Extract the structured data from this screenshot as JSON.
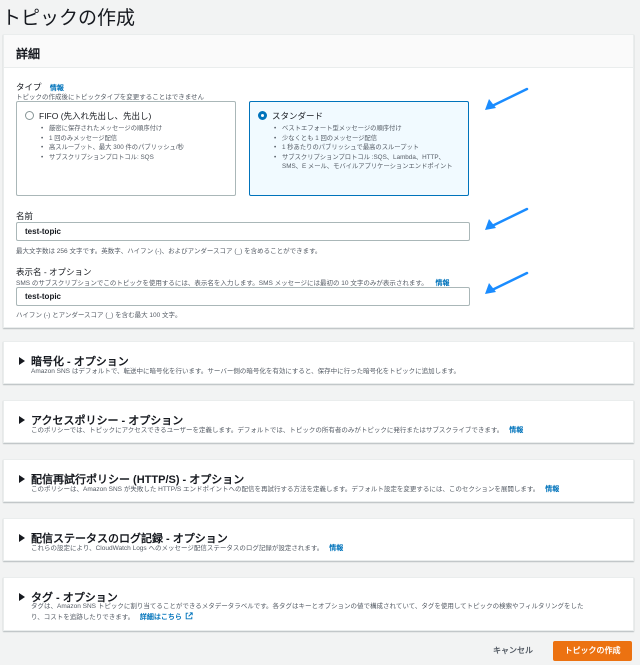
{
  "page": {
    "title": "トピックの作成"
  },
  "details": {
    "title": "詳細",
    "type": {
      "label": "タイプ",
      "info": "情報",
      "hint": "トピックの作成後にトピックタイプを変更することはできません",
      "options": [
        {
          "title": "FIFO (先入れ先出し、先出し)",
          "selected": false,
          "bullets": [
            "厳密に保存されたメッセージの順序付け",
            "1 回のみメッセージ配信",
            "高スループット、最大 300 件のパブリッシュ/秒",
            "サブスクリプションプロトコル: SQS"
          ]
        },
        {
          "title": "スタンダード",
          "selected": true,
          "bullets": [
            "ベストエフォート型メッセージの順序付け",
            "少なくとも 1 回のメッセージ配信",
            "1 秒あたりのパブリッシュで最高のスループット",
            "サブスクリプションプロトコル :SQS、Lambda、HTTP、SMS、E メール、モバイルアプリケーションエンドポイント"
          ]
        }
      ]
    },
    "name": {
      "label": "名前",
      "value": "test-topic",
      "hint": "最大文字数は 256 文字です。英数字、ハイフン (-)、およびアンダースコア (_) を含めることができます。"
    },
    "display_name": {
      "label": "表示名 - オプション",
      "hint_top": "SMS のサブスクリプションでこのトピックを使用するには、表示名を入力します。SMS メッセージには最初の 10 文字のみが表示されます。",
      "info": "情報",
      "value": "test-topic",
      "hint_bottom": "ハイフン (-) とアンダースコア (_) を含む最大 100 文字。"
    }
  },
  "sections": [
    {
      "title": "暗号化 - オプション",
      "desc": "Amazon SNS はデフォルトで、転送中に暗号化を行います。サーバー側の暗号化を有効にすると、保存中に行った暗号化をトピックに追加します。"
    },
    {
      "title": "アクセスポリシー - オプション",
      "desc": "このポリシーでは、トピックにアクセスできるユーザーを定義します。デフォルトでは、トピックの所有者のみがトピックに発行またはサブスクライブできます。",
      "info": "情報"
    },
    {
      "title": "配信再試行ポリシー (HTTP/S) - オプション",
      "desc": "このポリシーは、Amazon SNS が失敗した HTTP/S エンドポイントへの配信を再試行する方法を定義します。デフォルト設定を変更するには、このセクションを展開します。",
      "info": "情報"
    },
    {
      "title": "配信ステータスのログ記録 - オプション",
      "desc": "これらの設定により、CloudWatch Logs へのメッセージ配信ステータスのログ記録が設定されます。",
      "info": "情報"
    },
    {
      "title": "タグ - オプション",
      "desc_line1": "タグは、Amazon SNS トピックに割り当てることができるメタデータラベルです。各タグはキーとオプションの値で構成されていて、タグを使用してトピックの検索やフィルタリングをした",
      "desc_line2": "り、コストを追跡したりできます。",
      "link": "詳細はこちら"
    }
  ],
  "footer": {
    "cancel": "キャンセル",
    "create": "トピックの作成"
  },
  "colors": {
    "accent_arrow": "#1a8cff",
    "primary_button": "#ec7211",
    "link": "#0073bb"
  }
}
